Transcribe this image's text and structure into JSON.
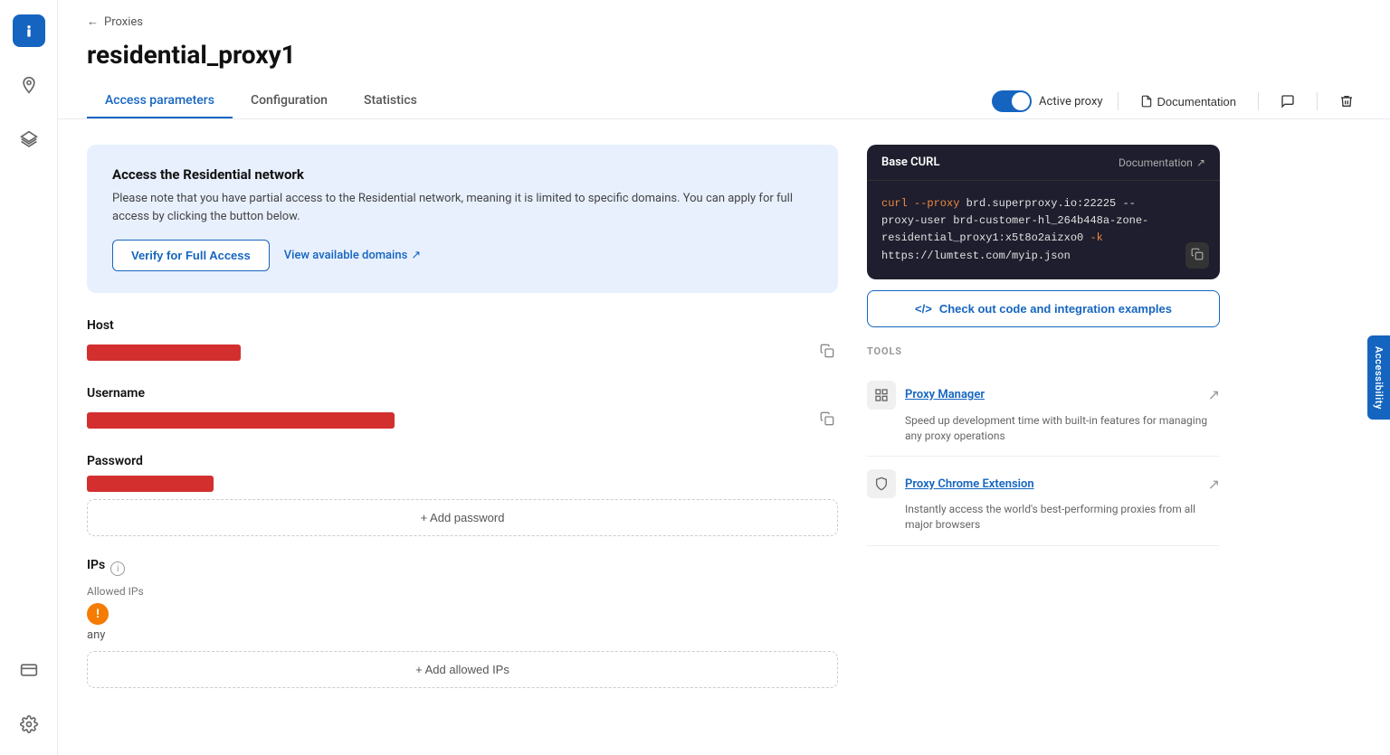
{
  "sidebar": {
    "items": [
      {
        "name": "info",
        "label": "Info",
        "active": true,
        "icon": "info"
      },
      {
        "name": "location",
        "label": "Location",
        "active": false,
        "icon": "location"
      },
      {
        "name": "layers",
        "label": "Layers",
        "active": false,
        "icon": "layers"
      },
      {
        "name": "card",
        "label": "Card",
        "active": false,
        "icon": "card"
      },
      {
        "name": "settings",
        "label": "Settings",
        "active": false,
        "icon": "settings"
      }
    ]
  },
  "breadcrumb": {
    "back_label": "Proxies"
  },
  "page": {
    "title": "residential_proxy1"
  },
  "tabs": [
    {
      "label": "Access parameters",
      "active": true
    },
    {
      "label": "Configuration",
      "active": false
    },
    {
      "label": "Statistics",
      "active": false
    }
  ],
  "header_actions": {
    "toggle_label": "Active proxy",
    "toggle_active": true,
    "doc_label": "Documentation",
    "delete_label": "Delete",
    "comment_label": "Comment"
  },
  "info_box": {
    "title": "Access the Residential network",
    "text": "Please note that you have partial access to the Residential network, meaning it is limited to specific domains. You can apply for full access by clicking the button below.",
    "verify_label": "Verify for Full Access",
    "domains_label": "View available domains"
  },
  "fields": {
    "host": {
      "label": "Host",
      "redacted_width": 170
    },
    "username": {
      "label": "Username",
      "redacted_width": 340
    },
    "password": {
      "label": "Password",
      "redacted_width": 140,
      "add_label": "+ Add password"
    }
  },
  "ips": {
    "label": "IPs",
    "allowed_ips_label": "Allowed IPs",
    "value": "any",
    "add_label": "+ Add allowed IPs"
  },
  "curl": {
    "title": "Base CURL",
    "doc_label": "Documentation",
    "line1": "curl --proxy brd.superproxy.io:22225 --",
    "line2": "proxy-user brd-customer-hl_264b448a-zone-",
    "line3": "residential_proxy1:x5t8o2aizxo0 -k",
    "line4": "https://lumtest.com/myip.json"
  },
  "integration": {
    "btn_label": "Check out code and integration examples"
  },
  "tools": {
    "label": "TOOLS",
    "items": [
      {
        "name": "Proxy Manager",
        "desc": "Speed up development time with built-in features for managing any proxy operations",
        "icon": "grid"
      },
      {
        "name": "Proxy Chrome Extension",
        "desc": "Instantly access the world's best-performing proxies from all major browsers",
        "icon": "shield"
      }
    ]
  },
  "accessibility": {
    "label": "Accessibility"
  }
}
